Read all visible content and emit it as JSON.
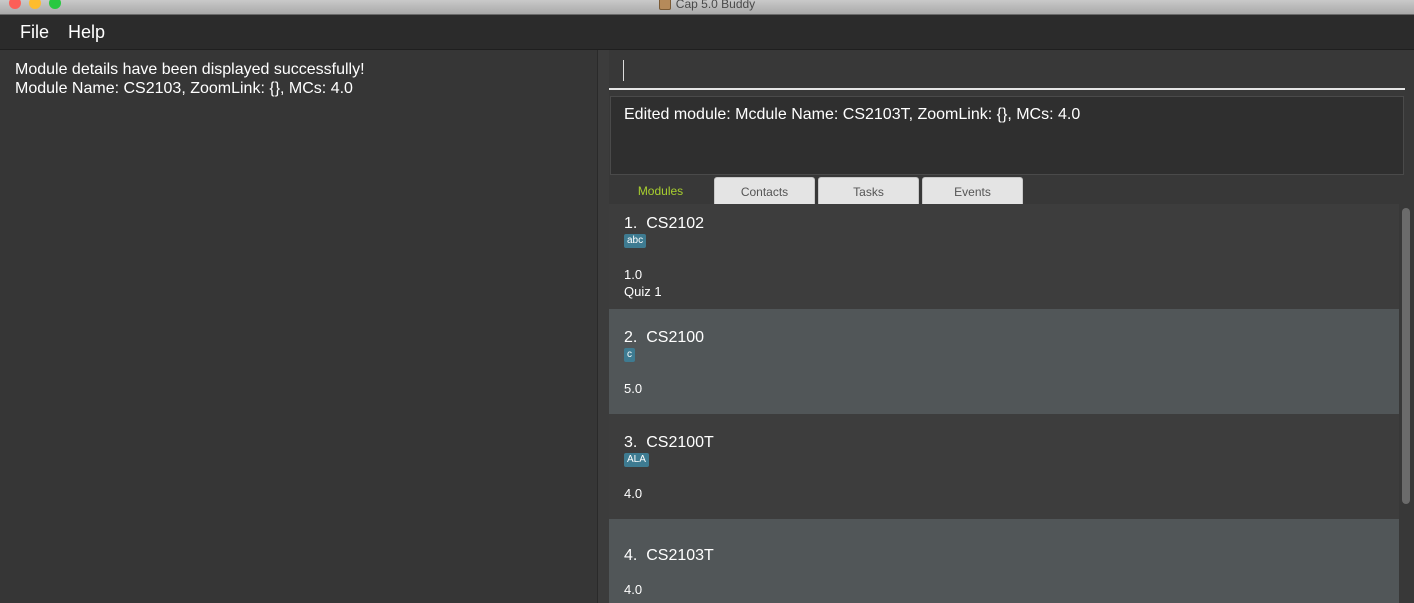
{
  "window": {
    "title": "Cap 5.0 Buddy"
  },
  "menu": {
    "file": "File",
    "help": "Help"
  },
  "left_panel": {
    "line1": "Module details have been displayed successfully!",
    "line2": "Module Name: CS2103, ZoomLink: {}, MCs: 4.0"
  },
  "command_box": {
    "value": ""
  },
  "result_display": {
    "text": "Edited module: Mcdule Name: CS2103T, ZoomLink: {}, MCs: 4.0"
  },
  "tabs": [
    {
      "label": "Modules",
      "active": true
    },
    {
      "label": "Contacts",
      "active": false
    },
    {
      "label": "Tasks",
      "active": false
    },
    {
      "label": "Events",
      "active": false
    }
  ],
  "modules": [
    {
      "title": "1.  CS2102",
      "tag": "abc",
      "mcs": "1.0",
      "extra": "Quiz 1"
    },
    {
      "title": "2.  CS2100",
      "tag": "c",
      "mcs": "5.0",
      "extra": ""
    },
    {
      "title": "3.  CS2100T",
      "tag": "ALA",
      "mcs": "4.0",
      "extra": ""
    },
    {
      "title": "4.  CS2103T",
      "tag": "",
      "mcs": "4.0",
      "extra": ""
    }
  ],
  "colors": {
    "accent_tab": "#a8cf2f",
    "tag_bg": "#3e7b91",
    "card_dark": "#3d3d3d",
    "card_light": "#515658"
  }
}
